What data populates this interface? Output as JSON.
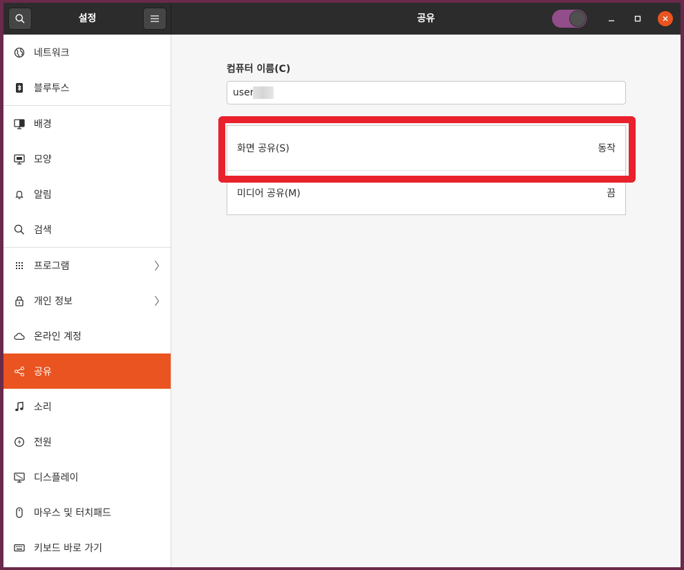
{
  "header": {
    "sidebar_title": "설정",
    "page_title": "공유",
    "search_icon": "search-icon",
    "menu_icon": "hamburger-menu-icon",
    "sharing_switch_on": true
  },
  "sidebar": {
    "items": [
      {
        "label": "네트워크",
        "icon": "network-globe-icon"
      },
      {
        "label": "블루투스",
        "icon": "bluetooth-icon"
      },
      {
        "label": "배경",
        "icon": "monitor-background-icon"
      },
      {
        "label": "모양",
        "icon": "appearance-icon"
      },
      {
        "label": "알림",
        "icon": "bell-icon"
      },
      {
        "label": "검색",
        "icon": "search-icon"
      },
      {
        "label": "프로그램",
        "icon": "apps-grid-icon"
      },
      {
        "label": "개인 정보",
        "icon": "lock-icon"
      },
      {
        "label": "온라인 계정",
        "icon": "cloud-icon"
      },
      {
        "label": "공유",
        "icon": "share-icon"
      },
      {
        "label": "소리",
        "icon": "music-note-icon"
      },
      {
        "label": "전원",
        "icon": "power-icon"
      },
      {
        "label": "디스플레이",
        "icon": "display-icon"
      },
      {
        "label": "마우스 및 터치패드",
        "icon": "mouse-icon"
      },
      {
        "label": "키보드 바로 가기",
        "icon": "keyboard-icon"
      }
    ],
    "active": "공유"
  },
  "content": {
    "computer_name_label": "컴퓨터 이름(C)",
    "computer_name_value": "user",
    "rows": [
      {
        "label": "화면 공유(S)",
        "status": "동작"
      },
      {
        "label": "미디어 공유(M)",
        "status": "끔"
      }
    ]
  },
  "colors": {
    "accent": "#e95420",
    "highlight": "#e8212c",
    "switch": "#924d8b",
    "headerbar": "#2c2c2c"
  }
}
